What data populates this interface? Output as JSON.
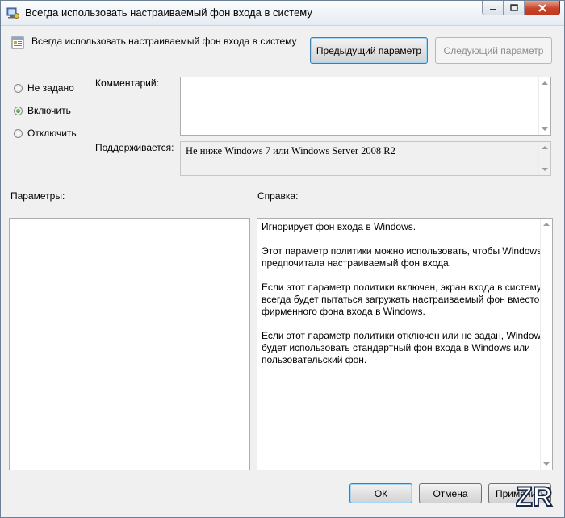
{
  "window": {
    "title": "Всегда использовать настраиваемый фон входа в систему"
  },
  "header": {
    "policy_name": "Всегда использовать настраиваемый фон входа в систему",
    "prev_button": "Предыдущий параметр",
    "next_button": "Следующий параметр"
  },
  "state_options": [
    {
      "label": "Не задано",
      "checked": false
    },
    {
      "label": "Включить",
      "checked": true
    },
    {
      "label": "Отключить",
      "checked": false
    }
  ],
  "comment": {
    "label": "Комментарий:",
    "value": ""
  },
  "supported": {
    "label": "Поддерживается:",
    "value": "Не ниже Windows 7 или Windows Server 2008 R2"
  },
  "options_label": "Параметры:",
  "help_label": "Справка:",
  "help_paragraphs": [
    "Игнорирует фон входа в Windows.",
    "Этот параметр политики можно использовать, чтобы Windows предпочитала настраиваемый фон входа.",
    "Если этот параметр политики включен, экран входа в систему всегда будет пытаться загружать настраиваемый фон вместо фирменного фона входа в Windows.",
    "Если этот параметр политики отключен или не задан, Windows будет использовать стандартный фон входа в Windows или пользовательский фон."
  ],
  "footer": {
    "ok": "ОК",
    "cancel": "Отмена",
    "apply": "Применить"
  },
  "watermark": "ZR"
}
